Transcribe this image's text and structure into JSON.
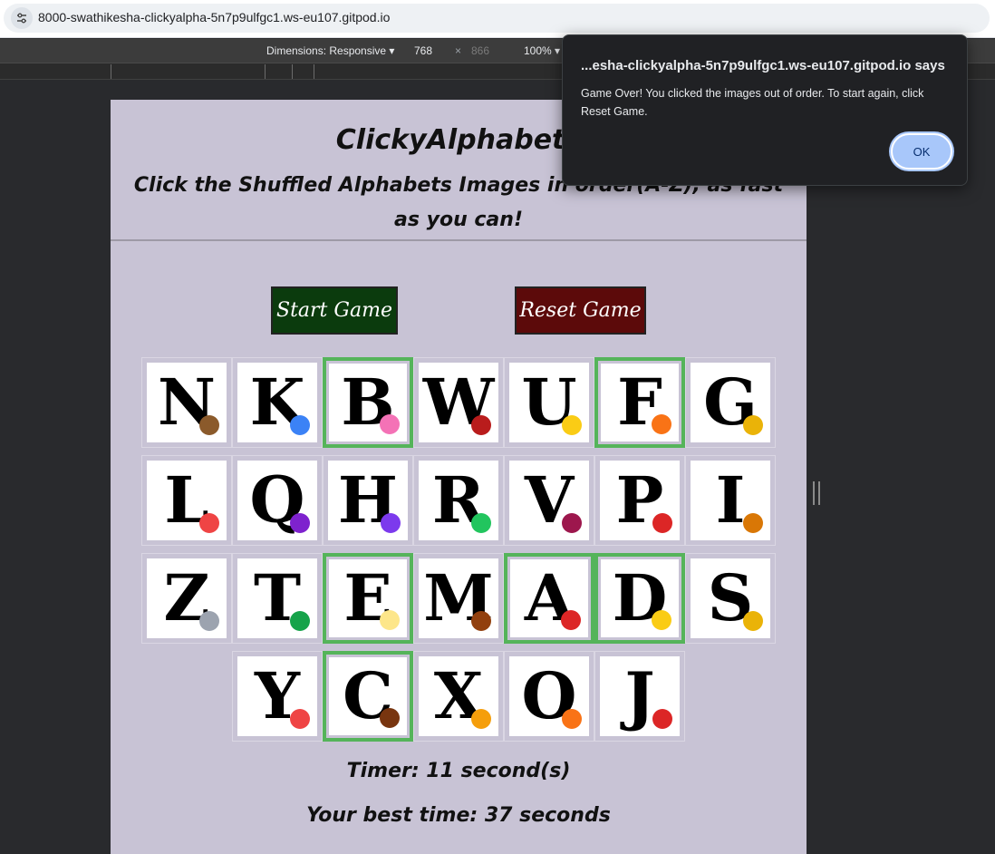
{
  "browser": {
    "url": "8000-swathikesha-clickyalpha-5n7p9ulfgc1.ws-eu107.gitpod.io"
  },
  "devtools": {
    "dimensions_label": "Dimensions: Responsive",
    "width_value": "768",
    "separator": "×",
    "height_value": "866",
    "zoom_label": "100%"
  },
  "page": {
    "title": "ClickyAlphabets",
    "subtitle": "Click the Shuffled Alphabets Images in order(A-Z), as fast as you can!",
    "start_button": "Start Game",
    "reset_button": "Reset Game",
    "timer_text": "Timer: 11 second(s)",
    "best_time_text": "Your best time: 37 seconds",
    "clicked_border_color": "#55b45a",
    "grid_rows": [
      [
        {
          "letter": "N",
          "clicked": false,
          "deco": "#8b5a2b"
        },
        {
          "letter": "K",
          "clicked": false,
          "deco": "#3b82f6"
        },
        {
          "letter": "B",
          "clicked": true,
          "deco": "#f472b6"
        },
        {
          "letter": "W",
          "clicked": false,
          "deco": "#b91c1c"
        },
        {
          "letter": "U",
          "clicked": false,
          "deco": "#facc15"
        },
        {
          "letter": "F",
          "clicked": true,
          "deco": "#f97316"
        },
        {
          "letter": "G",
          "clicked": false,
          "deco": "#eab308"
        }
      ],
      [
        {
          "letter": "L",
          "clicked": false,
          "deco": "#ef4444"
        },
        {
          "letter": "Q",
          "clicked": false,
          "deco": "#7e22ce"
        },
        {
          "letter": "H",
          "clicked": false,
          "deco": "#7c3aed"
        },
        {
          "letter": "R",
          "clicked": false,
          "deco": "#22c55e"
        },
        {
          "letter": "V",
          "clicked": false,
          "deco": "#9d174d"
        },
        {
          "letter": "P",
          "clicked": false,
          "deco": "#dc2626"
        },
        {
          "letter": "I",
          "clicked": false,
          "deco": "#d97706"
        }
      ],
      [
        {
          "letter": "Z",
          "clicked": false,
          "deco": "#9ca3af"
        },
        {
          "letter": "T",
          "clicked": false,
          "deco": "#16a34a"
        },
        {
          "letter": "E",
          "clicked": true,
          "deco": "#fde68a"
        },
        {
          "letter": "M",
          "clicked": false,
          "deco": "#92400e"
        },
        {
          "letter": "A",
          "clicked": true,
          "deco": "#dc2626"
        },
        {
          "letter": "D",
          "clicked": true,
          "deco": "#facc15"
        },
        {
          "letter": "S",
          "clicked": false,
          "deco": "#eab308"
        }
      ],
      [
        {
          "letter": "Y",
          "clicked": false,
          "deco": "#ef4444"
        },
        {
          "letter": "C",
          "clicked": true,
          "deco": "#78350f"
        },
        {
          "letter": "X",
          "clicked": false,
          "deco": "#f59e0b"
        },
        {
          "letter": "O",
          "clicked": false,
          "deco": "#f97316"
        },
        {
          "letter": "J",
          "clicked": false,
          "deco": "#dc2626"
        }
      ]
    ]
  },
  "alert": {
    "title": "...esha-clickyalpha-5n7p9ulfgc1.ws-eu107.gitpod.io says",
    "message": "Game Over! You clicked the images out of order. To start again, click Reset Game.",
    "ok_label": "OK"
  }
}
